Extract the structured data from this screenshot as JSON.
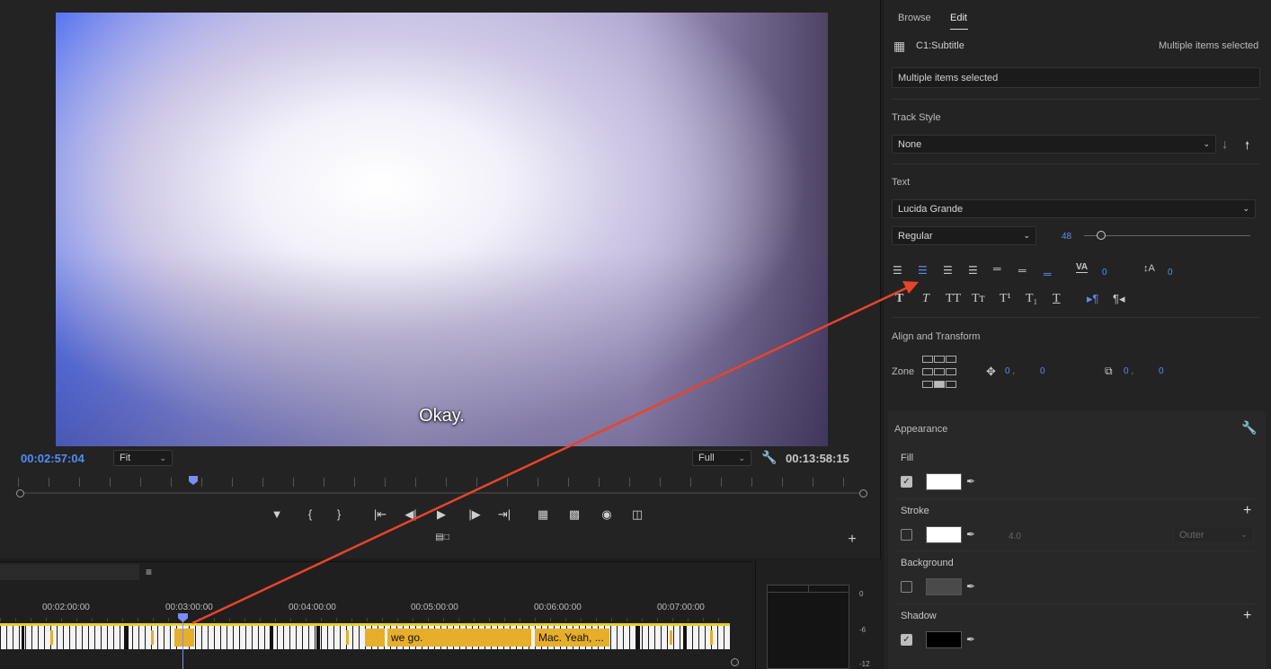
{
  "monitor": {
    "caption": "Okay.",
    "current_time": "00:02:57:04",
    "zoom": "Fit",
    "resolution": "Full",
    "duration": "00:13:58:15"
  },
  "timeline": {
    "ruler": [
      "00:02:00:00",
      "00:03:00:00",
      "00:04:00:00",
      "00:05:00:00",
      "00:06:00:00",
      "00:07:00:00"
    ],
    "clips": [
      "we go.",
      "Mac. Yeah, ..."
    ]
  },
  "meter": {
    "labels": [
      "0",
      "-6",
      "-12"
    ]
  },
  "panel": {
    "tabs": [
      "Browse",
      "Edit"
    ],
    "active_tab": "Edit",
    "track_name": "C1:Subtitle",
    "selection_status": "Multiple items selected",
    "text_box": "Multiple items selected",
    "track_style": {
      "label": "Track Style",
      "value": "None"
    },
    "text": {
      "label": "Text",
      "font": "Lucida Grande",
      "weight": "Regular",
      "size": "48",
      "size_fraction": 0.1,
      "tracking": "0",
      "leading": "0"
    },
    "align": {
      "label": "Align and Transform",
      "zone_label": "Zone",
      "pos_x": "0 ,",
      "pos_y": "0",
      "scale_x": "0 ,",
      "scale_y": "0"
    },
    "appearance": {
      "label": "Appearance",
      "fill": {
        "label": "Fill",
        "checked": true,
        "color": "#ffffff"
      },
      "stroke": {
        "label": "Stroke",
        "checked": false,
        "color": "#ffffff",
        "width": "4.0",
        "position": "Outer"
      },
      "background": {
        "label": "Background",
        "checked": false,
        "color": "#4a4a4a"
      },
      "shadow": {
        "label": "Shadow",
        "checked": true,
        "color": "#000000"
      }
    }
  },
  "colors": {
    "accent": "#5c8df5",
    "clip": "#e7ae2a",
    "arrow": "#e8442b"
  }
}
